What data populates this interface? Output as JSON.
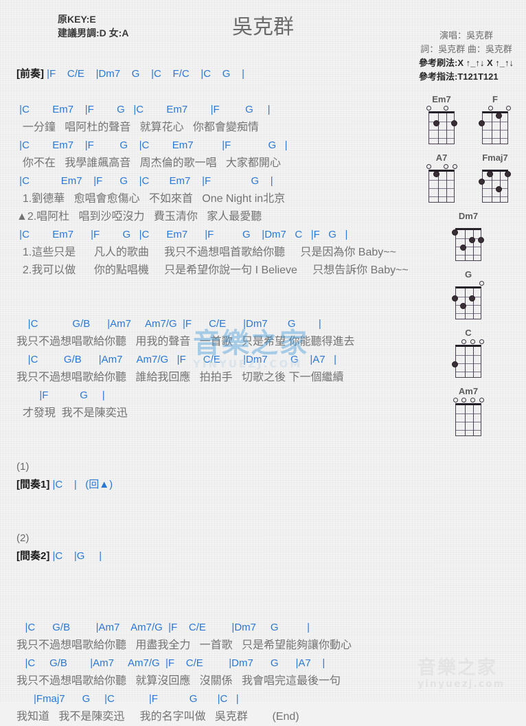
{
  "header": {
    "orig_key": "原KEY:E",
    "suggest_key": "建議男調:D 女:A",
    "title": "吳克群",
    "singer": "演唱：吳克群",
    "credits": "詞：吳克群  曲：吳克群",
    "strum": "參考刷法:X ↑_↑↓ X ↑_↑↓",
    "fingering": "參考指法:T121T121"
  },
  "accent_color": "#2a78d4",
  "lyric_color": "#737373",
  "sheet": [
    {
      "type": "section",
      "tag": "[前奏]",
      "chords": " |F    C/E    |Dm7    G    |C    F/C    |C    G    |"
    },
    {
      "type": "spacer"
    },
    {
      "type": "chord",
      "text": " |C        Em7    |F        G   |C        Em7        |F         G     |"
    },
    {
      "type": "lyric",
      "text": "  一分鐘   唱阿杜的聲音   就算花心   你都會變痴情"
    },
    {
      "type": "chord",
      "text": " |C        Em7    |F         G    |C        Em7          |F             G   |"
    },
    {
      "type": "lyric",
      "text": "  你不在   我學誰飆高音   周杰倫的歌一唱   大家都開心"
    },
    {
      "type": "chord",
      "text": " |C           Em7    |F      G    |C       Em7    |F              G    |"
    },
    {
      "type": "lyric",
      "text": "  1.劉德華   愈唱會愈傷心   不如來首   One Night in北京"
    },
    {
      "type": "lyric",
      "text": "▲2.唱阿杜   唱到沙啞沒力   費玉清你   家人最愛聽"
    },
    {
      "type": "chord",
      "text": " |C        Em7      |F        G   |C      Em7      |F          G    |Dm7   C   |F   G   |"
    },
    {
      "type": "lyric",
      "text": "  1.這些只是      凡人的歌曲     我只不過想唱首歌給你聽     只是因為你 Baby~~"
    },
    {
      "type": "lyric",
      "text": "  2.我可以做      你的點唱機     只是希望你說一句 I Believe     只想告訴你 Baby~~"
    },
    {
      "type": "spacer"
    },
    {
      "type": "spacer"
    },
    {
      "type": "chord",
      "text": "    |C            G/B      |Am7     Am7/G  |F      C/E      |Dm7       G        |"
    },
    {
      "type": "lyric",
      "text": "我只不過想唱歌給你聽   用我的聲音   一首歌   只是希望 你能聽得進去"
    },
    {
      "type": "chord",
      "text": "    |C         G/B      |Am7     Am7/G   |F      C/E        |Dm7        G    |A7   |"
    },
    {
      "type": "lyric",
      "text": "我只不過想唱歌給你聽   誰給我回應   拍拍手   切歌之後 下一個繼續"
    },
    {
      "type": "chord",
      "text": "        |F           G     |"
    },
    {
      "type": "lyric",
      "text": "  才發現  我不是陳奕迅"
    },
    {
      "type": "spacer"
    },
    {
      "type": "spacer"
    },
    {
      "type": "mark",
      "text": "(1)"
    },
    {
      "type": "section",
      "tag": "[間奏1]",
      "chords": " |C    |   (回▲)"
    },
    {
      "type": "spacer"
    },
    {
      "type": "spacer"
    },
    {
      "type": "mark",
      "text": "(2)"
    },
    {
      "type": "section",
      "tag": "[間奏2]",
      "chords": " |C    |G     |"
    },
    {
      "type": "spacer"
    },
    {
      "type": "spacer"
    },
    {
      "type": "spacer"
    },
    {
      "type": "chord",
      "text": "   |C      G/B         |Am7    Am7/G  |F    C/E         |Dm7     G          |"
    },
    {
      "type": "lyric",
      "text": "我只不過想唱歌給你聽   用盡我全力   一首歌   只是希望能夠讓你動心"
    },
    {
      "type": "chord",
      "text": "   |C     G/B        |Am7     Am7/G  |F    C/E         |Dm7      G      |A7    |"
    },
    {
      "type": "lyric",
      "text": "我只不過想唱歌給你聽   就算沒回應   沒關係   我會唱完這最後一句"
    },
    {
      "type": "chord",
      "text": "      |Fmaj7      G     |C            |F           G       |C   |"
    },
    {
      "type": "lyric",
      "text": "我知道   我不是陳奕迅     我的名字叫做   吳克群        (End)"
    }
  ],
  "diagrams": [
    {
      "name": "Em7",
      "opens": [
        1,
        3
      ],
      "dots": [
        [
          2,
          2
        ],
        [
          2,
          4
        ]
      ]
    },
    {
      "name": "F",
      "opens": [
        2,
        4
      ],
      "dots": [
        [
          1,
          3
        ],
        [
          2,
          1
        ]
      ]
    },
    {
      "name": "A7",
      "opens": [
        1,
        3,
        4
      ],
      "dots": [
        [
          1,
          2
        ]
      ]
    },
    {
      "name": "Fmaj7",
      "opens": [],
      "dots": [
        [
          1,
          2
        ],
        [
          1,
          4
        ],
        [
          2,
          1
        ],
        [
          3,
          3
        ]
      ]
    },
    {
      "name": "Dm7",
      "opens": [],
      "dots": [
        [
          1,
          1
        ],
        [
          2,
          3
        ],
        [
          2,
          4
        ],
        [
          3,
          2
        ]
      ]
    },
    {
      "name": "G",
      "opens": [
        4
      ],
      "dots": [
        [
          2,
          1
        ],
        [
          2,
          3
        ],
        [
          3,
          2
        ]
      ]
    },
    {
      "name": "C",
      "opens": [
        2,
        3,
        4
      ],
      "dots": [
        [
          3,
          1
        ]
      ]
    },
    {
      "name": "Am7",
      "opens": [
        1,
        2,
        3,
        4
      ],
      "dots": []
    }
  ],
  "watermark": {
    "mid_cjk": "音樂之家",
    "mid_lat": "YINYUEZJ.COM",
    "bot_cjk": "音樂之家",
    "bot_lat": "yinyuezj.com"
  }
}
